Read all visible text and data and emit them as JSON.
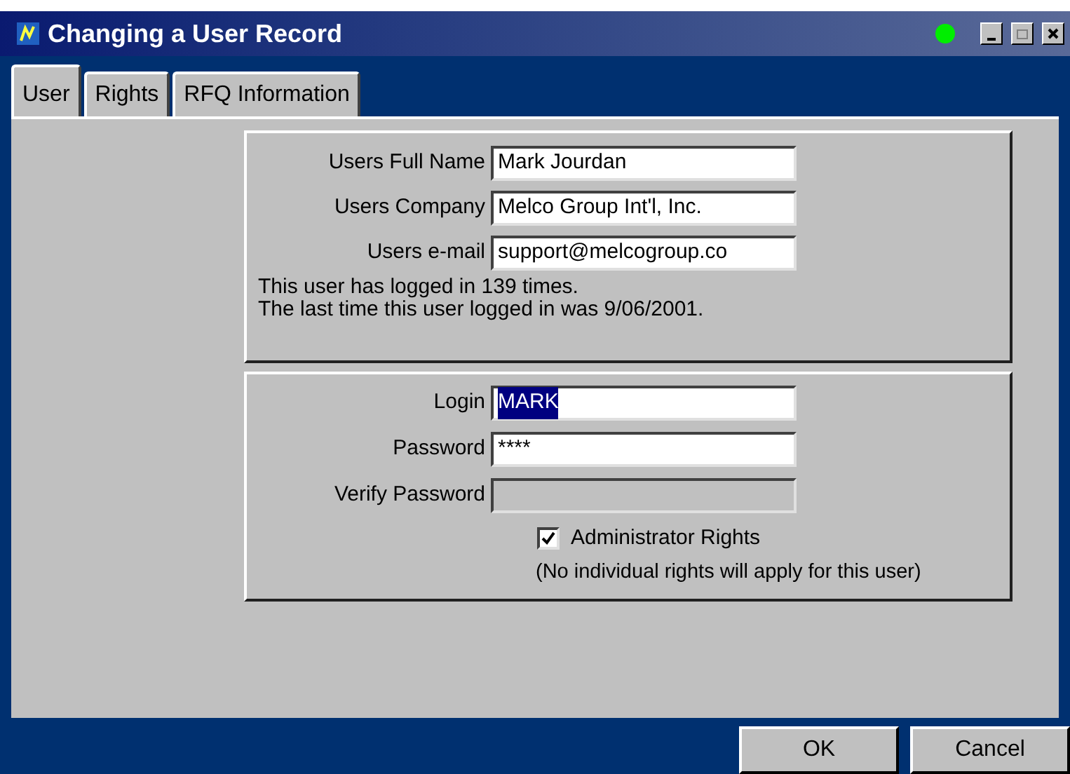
{
  "window": {
    "title": "Changing a User Record"
  },
  "tabs": [
    {
      "label": "User",
      "selected": true
    },
    {
      "label": "Rights",
      "selected": false
    },
    {
      "label": "RFQ Information",
      "selected": false
    }
  ],
  "user_info": {
    "fields": [
      {
        "label": "Users Full Name",
        "value": "Mark Jourdan"
      },
      {
        "label": "Users Company",
        "value": "Melco Group Int'l, Inc."
      },
      {
        "label": "Users e-mail",
        "value": "support@melcogroup.co"
      }
    ],
    "notes": [
      "This user has logged in 139 times.",
      "The last time this user logged in was  9/06/2001."
    ]
  },
  "login_info": {
    "fields": [
      {
        "label": "Login",
        "value": "MARK",
        "highlighted": true,
        "disabled": false
      },
      {
        "label": "Password",
        "value": "****",
        "disabled": false
      },
      {
        "label": "Verify Password",
        "disabled": true
      }
    ],
    "admin_rights": {
      "label": "Administrator Rights",
      "checked": true
    },
    "note": "(No individual rights will apply for this user)"
  },
  "buttons": [
    "OK",
    "Cancel"
  ]
}
